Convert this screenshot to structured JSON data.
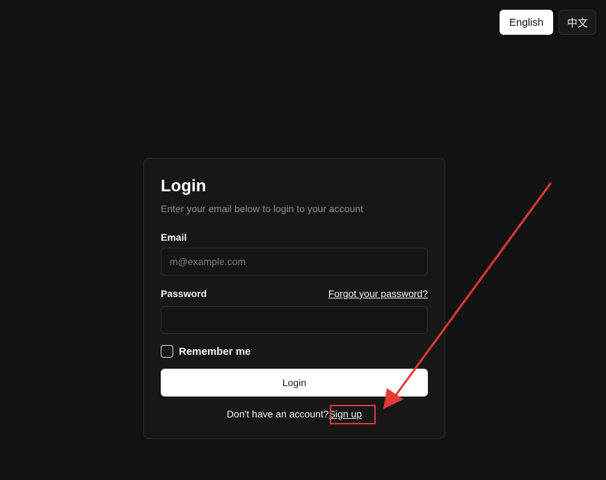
{
  "language": {
    "english_label": "English",
    "chinese_label": "中文"
  },
  "login_card": {
    "title": "Login",
    "subtitle": "Enter your email below to login to your account",
    "email_label": "Email",
    "email_placeholder": "m@example.com",
    "email_value": "",
    "password_label": "Password",
    "password_value": "",
    "forgot_label": "Forgot your password?",
    "remember_label": "Remember me",
    "remember_checked": false,
    "login_button": "Login",
    "signup_prompt": "Don't have an account?",
    "signup_link": "Sign up"
  },
  "annotation": {
    "color": "#e53935"
  }
}
